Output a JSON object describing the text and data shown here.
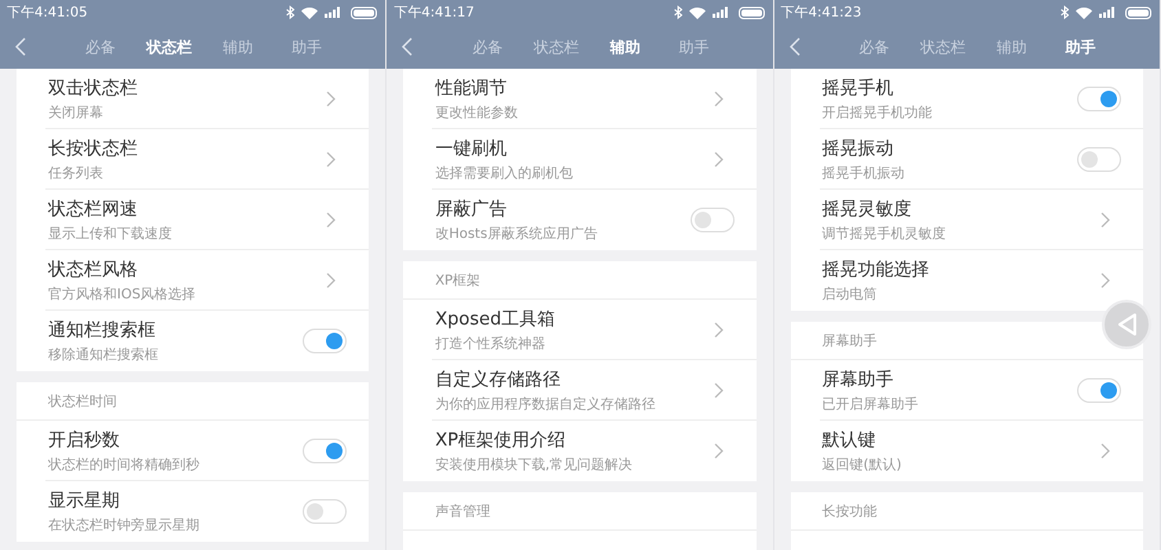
{
  "screens": [
    {
      "status_time": "下午4:41:05",
      "tabs": [
        {
          "label": "必备",
          "selected": false
        },
        {
          "label": "状态栏",
          "selected": true
        },
        {
          "label": "辅助",
          "selected": false
        },
        {
          "label": "助手",
          "selected": false
        }
      ],
      "sections": [
        {
          "items": [
            {
              "title": "双击状态栏",
              "subtitle": "关闭屏幕",
              "kind": "chevron"
            },
            {
              "title": "长按状态栏",
              "subtitle": "任务列表",
              "kind": "chevron"
            },
            {
              "title": "状态栏网速",
              "subtitle": "显示上传和下载速度",
              "kind": "chevron"
            },
            {
              "title": "状态栏风格",
              "subtitle": "官方风格和IOS风格选择",
              "kind": "chevron"
            },
            {
              "title": "通知栏搜索框",
              "subtitle": "移除通知栏搜索框",
              "kind": "toggle",
              "on": true
            }
          ]
        },
        {
          "header": "状态栏时间",
          "items": [
            {
              "title": "开启秒数",
              "subtitle": "状态栏的时间将精确到秒",
              "kind": "toggle",
              "on": true
            },
            {
              "title": "显示星期",
              "subtitle": "在状态栏时钟旁显示星期",
              "kind": "toggle",
              "on": false
            }
          ]
        }
      ]
    },
    {
      "status_time": "下午4:41:17",
      "tabs": [
        {
          "label": "必备",
          "selected": false
        },
        {
          "label": "状态栏",
          "selected": false
        },
        {
          "label": "辅助",
          "selected": true
        },
        {
          "label": "助手",
          "selected": false
        }
      ],
      "sections": [
        {
          "items": [
            {
              "title": "性能调节",
              "subtitle": "更改性能参数",
              "kind": "chevron"
            },
            {
              "title": "一键刷机",
              "subtitle": "选择需要刷入的刷机包",
              "kind": "chevron"
            },
            {
              "title": "屏蔽广告",
              "subtitle": "改Hosts屏蔽系统应用广告",
              "kind": "toggle",
              "on": false
            }
          ]
        },
        {
          "header": "XP框架",
          "items": [
            {
              "title": "Xposed工具箱",
              "subtitle": "打造个性系统神器",
              "kind": "chevron"
            },
            {
              "title": "自定义存储路径",
              "subtitle": "为你的应用程序数据自定义存储路径",
              "kind": "chevron"
            },
            {
              "title": "XP框架使用介绍",
              "subtitle": "安装使用模块下载,常见问题解决",
              "kind": "chevron"
            }
          ]
        },
        {
          "header": "声音管理"
        }
      ]
    },
    {
      "status_time": "下午4:41:23",
      "tabs": [
        {
          "label": "必备",
          "selected": false
        },
        {
          "label": "状态栏",
          "selected": false
        },
        {
          "label": "辅助",
          "selected": false
        },
        {
          "label": "助手",
          "selected": true
        }
      ],
      "floating_back": true,
      "sections": [
        {
          "items": [
            {
              "title": "摇晃手机",
              "subtitle": "开启摇晃手机功能",
              "kind": "toggle",
              "on": true
            },
            {
              "title": "摇晃振动",
              "subtitle": "摇晃手机振动",
              "kind": "toggle",
              "on": false
            },
            {
              "title": "摇晃灵敏度",
              "subtitle": "调节摇晃手机灵敏度",
              "kind": "chevron"
            },
            {
              "title": "摇晃功能选择",
              "subtitle": "启动电筒",
              "kind": "chevron"
            }
          ]
        },
        {
          "header": "屏幕助手",
          "items": [
            {
              "title": "屏幕助手",
              "subtitle": "已开启屏幕助手",
              "kind": "toggle",
              "on": true
            },
            {
              "title": "默认键",
              "subtitle": "返回键(默认)",
              "kind": "chevron"
            }
          ]
        },
        {
          "header": "长按功能"
        }
      ]
    }
  ]
}
